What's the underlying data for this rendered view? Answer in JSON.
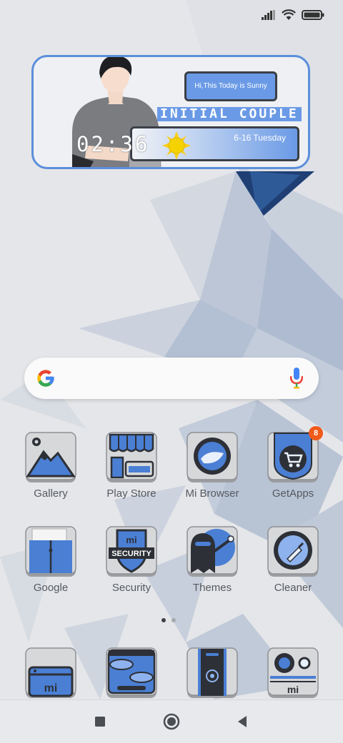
{
  "status_bar": {
    "icons": [
      "signal-icon",
      "wifi-icon",
      "battery-icon"
    ]
  },
  "widget": {
    "greeting": "Hi,This Today is Sunny",
    "title": "INITIAL COUPLE",
    "time": "02:36",
    "date": "6-16  Tuesday",
    "weather_icon": "sun-icon"
  },
  "search": {
    "logo": "google-logo",
    "voice_icon": "mic-icon"
  },
  "apps": [
    {
      "label": "Gallery"
    },
    {
      "label": "Play Store"
    },
    {
      "label": "Mi Browser"
    },
    {
      "label": "GetApps",
      "badge": "8"
    },
    {
      "label": "Google"
    },
    {
      "label": "Security"
    },
    {
      "label": "Themes"
    },
    {
      "label": "Cleaner"
    }
  ],
  "page_indicator": {
    "pages": 2,
    "current": 1
  },
  "dock": [
    {
      "name": "mi-browser-window-icon"
    },
    {
      "name": "messaging-icon"
    },
    {
      "name": "chrome-phone-icon"
    },
    {
      "name": "mi-camera-icon"
    }
  ],
  "colors": {
    "accent": "#5b8fdb",
    "dark": "#3b3f46",
    "badge": "#f05a1a"
  }
}
